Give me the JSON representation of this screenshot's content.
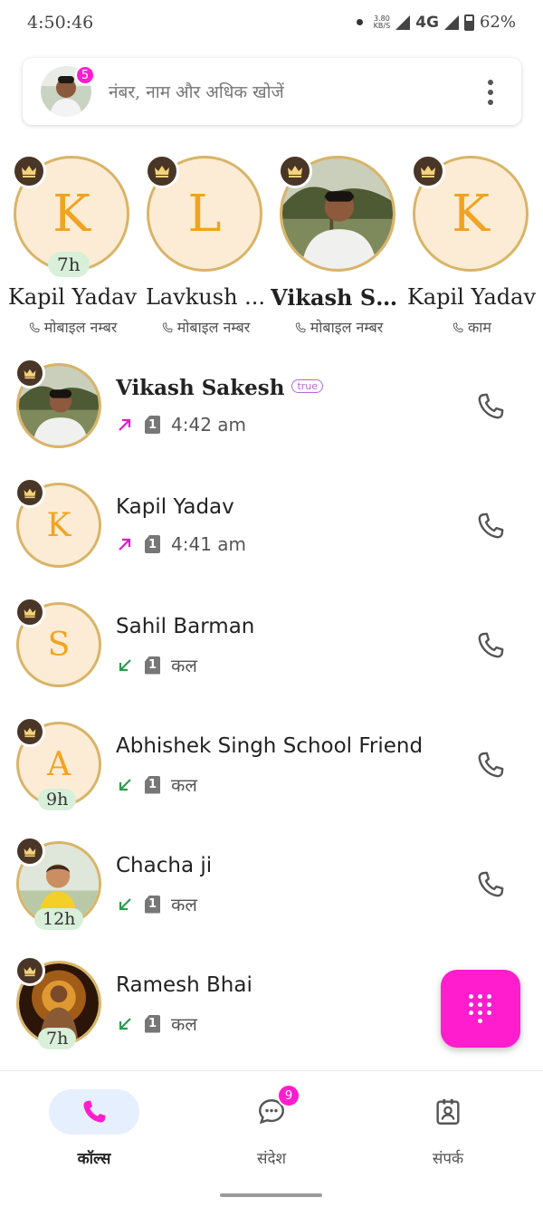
{
  "status_bar": {
    "time": "4:50:46",
    "speed_top": "3.80",
    "speed_bottom": "KB/S",
    "network": "4G",
    "battery": "62%"
  },
  "search": {
    "placeholder": "नंबर, नाम और अधिक खोजें",
    "notification_count": "5"
  },
  "favorites": [
    {
      "letter": "K",
      "name": "Kapil Yadav",
      "sub": "मोबाइल नम्बर",
      "time": "7h"
    },
    {
      "letter": "L",
      "name": "Lavkush ...",
      "sub": "मोबाइल नम्बर",
      "time": ""
    },
    {
      "letter": "",
      "name": "Vikash Sa...",
      "sub": "मोबाइल नम्बर",
      "time": ""
    },
    {
      "letter": "K",
      "name": "Kapil Yadav",
      "sub": "काम",
      "time": ""
    }
  ],
  "calls": [
    {
      "letter": "",
      "name": "Vikash Sakesh",
      "badge": "true",
      "direction": "outgoing",
      "sim": "1",
      "time": "4:42 am",
      "chip": ""
    },
    {
      "letter": "K",
      "name": "Kapil Yadav",
      "badge": "",
      "direction": "outgoing",
      "sim": "1",
      "time": "4:41 am",
      "chip": ""
    },
    {
      "letter": "S",
      "name": "Sahil Barman",
      "badge": "",
      "direction": "incoming",
      "sim": "1",
      "time": "कल",
      "chip": ""
    },
    {
      "letter": "A",
      "name": "Abhishek Singh School Friend",
      "badge": "",
      "direction": "incoming",
      "sim": "1",
      "time": "कल",
      "chip": "9h"
    },
    {
      "letter": "",
      "name": "Chacha ji",
      "badge": "",
      "direction": "incoming",
      "sim": "1",
      "time": "कल",
      "chip": "12h"
    },
    {
      "letter": "",
      "name": "Ramesh Bhai",
      "badge": "",
      "direction": "incoming",
      "sim": "1",
      "time": "कल",
      "chip": "7h"
    }
  ],
  "bottom_nav": {
    "calls": "कॉल्स",
    "messages": "संदेश",
    "messages_badge": "9",
    "contacts": "संपर्क"
  },
  "colors": {
    "accent_pink": "#ff1dce",
    "gold_ring": "#d9b468",
    "avatar_bg": "#fcecd5",
    "letter": "#f2a31f",
    "outgoing_arrow": "#e01bc8",
    "incoming_arrow": "#2e9b52",
    "time_chip": "#d8efd9",
    "nav_active": "#e6effd"
  },
  "icons": {
    "crown": "crown-icon",
    "call": "phone-icon",
    "dialpad": "dialpad-icon",
    "messages": "chat-bubble-icon",
    "contacts": "contact-card-icon",
    "menu": "more-vertical-icon"
  }
}
